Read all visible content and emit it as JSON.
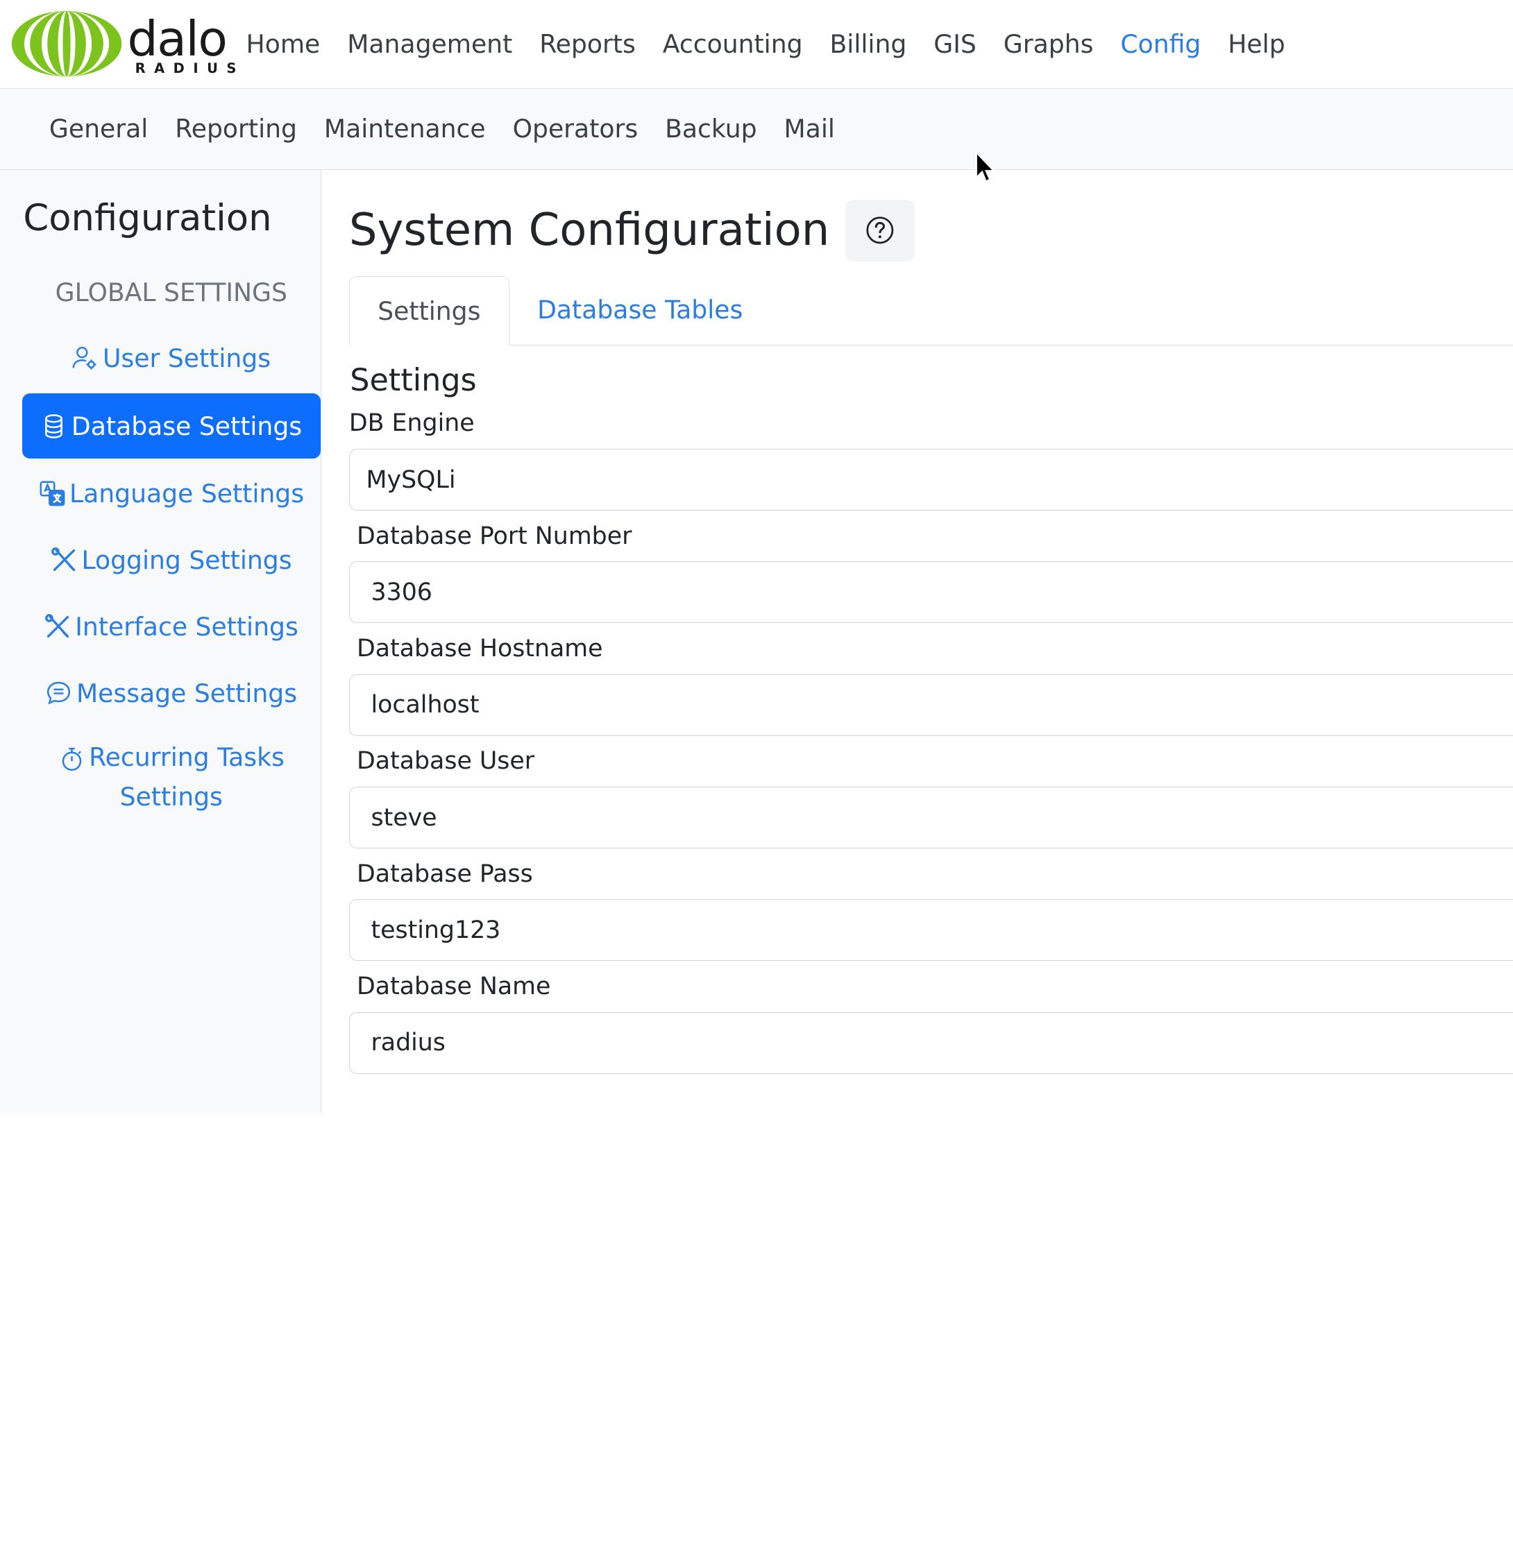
{
  "brand": {
    "logo_main": "dalo",
    "logo_sub": "RADIUS"
  },
  "topnav": {
    "items": [
      "Home",
      "Management",
      "Reports",
      "Accounting",
      "Billing",
      "GIS",
      "Graphs",
      "Config",
      "Help"
    ],
    "active": "Config"
  },
  "subnav": {
    "items": [
      "General",
      "Reporting",
      "Maintenance",
      "Operators",
      "Backup",
      "Mail"
    ]
  },
  "sidebar": {
    "title": "Configuration",
    "heading": "GLOBAL SETTINGS",
    "items": [
      {
        "label": "User Settings",
        "icon": "user-gear-icon"
      },
      {
        "label": "Database Settings",
        "icon": "database-icon",
        "active": true
      },
      {
        "label": "Language Settings",
        "icon": "translate-icon"
      },
      {
        "label": "Logging Settings",
        "icon": "tools-icon"
      },
      {
        "label": "Interface Settings",
        "icon": "tools-icon"
      },
      {
        "label": "Message Settings",
        "icon": "chat-icon"
      },
      {
        "label": "Recurring Tasks Settings",
        "label_line1": "Recurring Tasks",
        "label_line2": "Settings",
        "icon": "stopwatch-icon"
      }
    ]
  },
  "main": {
    "title": "System Configuration",
    "help_icon": "question-circle-icon",
    "tabs": [
      {
        "label": "Settings",
        "active": true
      },
      {
        "label": "Database Tables"
      }
    ],
    "section_title": "Settings",
    "fields": [
      {
        "label": "DB Engine",
        "value": "MySQLi",
        "type": "select"
      },
      {
        "label": "Database Port Number",
        "value": "3306"
      },
      {
        "label": "Database Hostname",
        "value": "localhost"
      },
      {
        "label": "Database User",
        "value": "steve"
      },
      {
        "label": "Database Pass",
        "value": "testing123"
      },
      {
        "label": "Database Name",
        "value": "radius"
      }
    ]
  },
  "colors": {
    "accent": "#0d6efd",
    "link": "#2a7de1",
    "logo_green": "#7dc31e"
  }
}
